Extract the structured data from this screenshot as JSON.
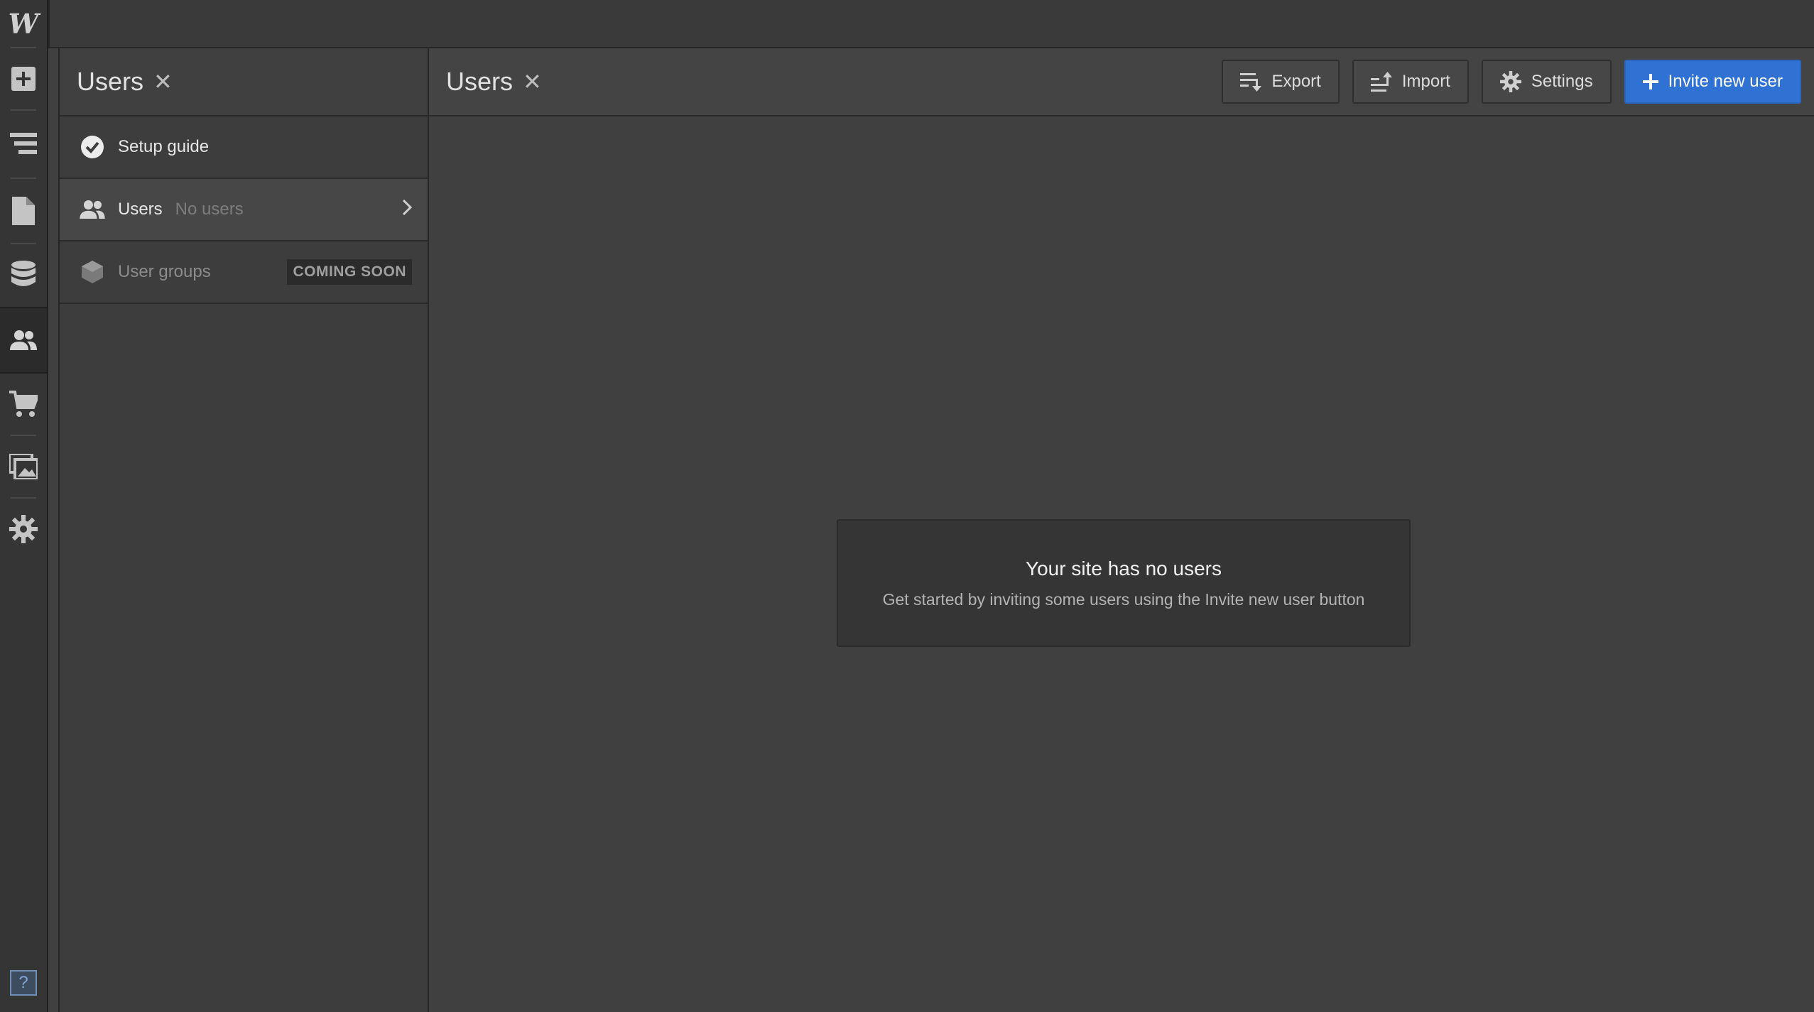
{
  "app": {
    "logo": "W",
    "help_label": "?"
  },
  "rail": {
    "items": [
      {
        "name": "add-panel",
        "icon": "plus-square-icon"
      },
      {
        "name": "navigator",
        "icon": "navigator-icon"
      },
      {
        "name": "pages",
        "icon": "page-icon"
      },
      {
        "name": "cms",
        "icon": "database-icon"
      },
      {
        "name": "users",
        "icon": "users-icon",
        "active": true
      },
      {
        "name": "ecommerce",
        "icon": "cart-icon"
      },
      {
        "name": "assets",
        "icon": "images-icon"
      },
      {
        "name": "settings",
        "icon": "gear-icon"
      }
    ]
  },
  "panel": {
    "title": "Users",
    "close_label": "✕",
    "items": [
      {
        "label": "Setup guide",
        "icon": "check-circle-icon"
      },
      {
        "label": "Users",
        "sublabel": "No users",
        "icon": "users-icon"
      },
      {
        "label": "User groups",
        "badge": "COMING SOON",
        "icon": "cube-icon"
      }
    ]
  },
  "main": {
    "title": "Users",
    "close_label": "✕",
    "buttons": {
      "export": "Export",
      "import": "Import",
      "settings": "Settings",
      "invite": "Invite new user"
    },
    "empty_state": {
      "title": "Your site has no users",
      "subtitle": "Get started by inviting some users using the Invite new user button"
    }
  },
  "colors": {
    "primary": "#2f72d4",
    "background": "#404040",
    "rail": "#353535"
  }
}
